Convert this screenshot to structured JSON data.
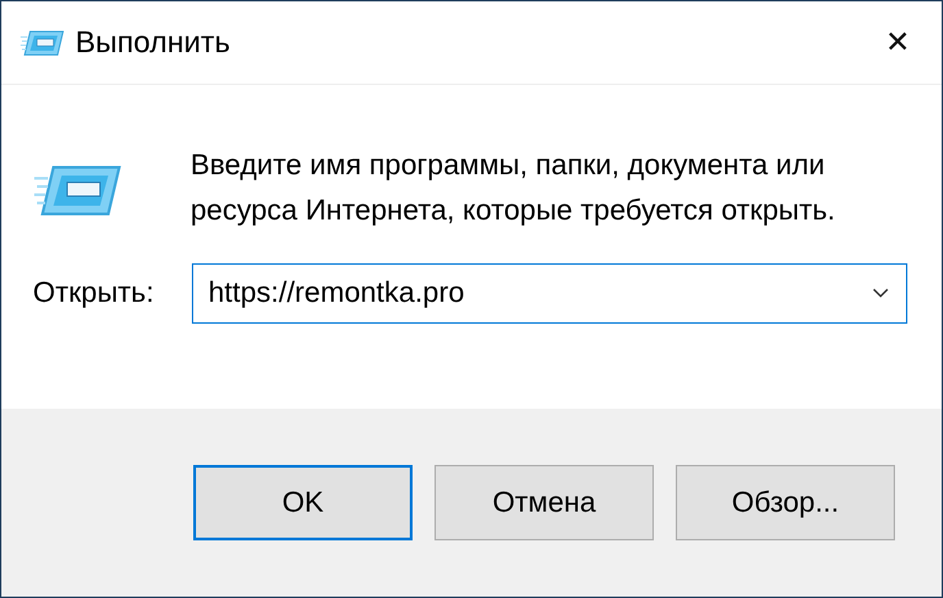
{
  "window": {
    "title": "Выполнить",
    "close": "✕"
  },
  "description": "Введите имя программы, папки, документа или ресурса Интернета, которые требуется открыть.",
  "open_field": {
    "label": "Открыть:",
    "value": "https://remontka.pro"
  },
  "buttons": [
    {
      "label": "OK",
      "default": true
    },
    {
      "label": "Отмена",
      "default": false
    },
    {
      "label": "Обзор...",
      "default": false
    }
  ]
}
